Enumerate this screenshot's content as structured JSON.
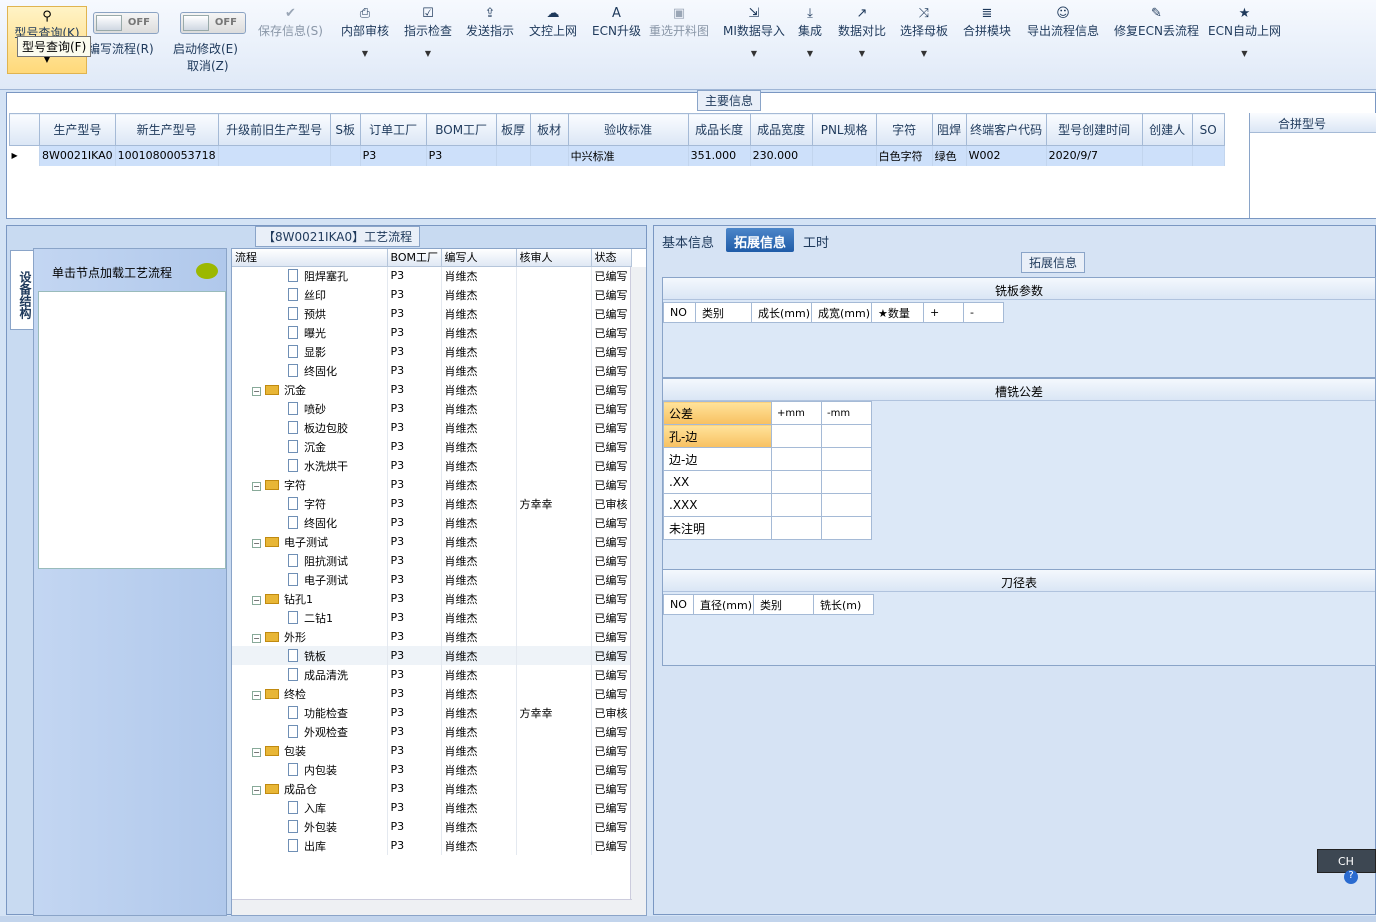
{
  "toolbar": {
    "query_label": "型号查询(K)",
    "tooltip": "型号查询(F)",
    "switch1": {
      "state": "OFF",
      "label": "编写流程(R)"
    },
    "switch2": {
      "state": "OFF",
      "label": "启动修改(E)",
      "label2": "取消(Z)"
    },
    "buttons": [
      {
        "label": "保存信息(S)",
        "icon": "check-icon"
      },
      {
        "label": "内部审核",
        "icon": "print-icon"
      },
      {
        "label": "指示检查",
        "icon": "checklist-icon"
      },
      {
        "label": "发送指示",
        "icon": "upload-icon"
      },
      {
        "label": "文控上网",
        "icon": "cloud-upload-icon"
      },
      {
        "label": "ECN升级",
        "icon": "upgrade-icon"
      },
      {
        "label": "重选开料图",
        "icon": "image-icon"
      },
      {
        "label": "MI数据导入",
        "icon": "import-icon"
      },
      {
        "label": "集成",
        "icon": "download-icon"
      },
      {
        "label": "数据对比",
        "icon": "compare-icon"
      },
      {
        "label": "选择母板",
        "icon": "shuffle-icon"
      },
      {
        "label": "合拼模块",
        "icon": "list-icon"
      },
      {
        "label": "导出流程信息",
        "icon": "smile-icon"
      },
      {
        "label": "修复ECN丢流程",
        "icon": "wrench-icon"
      },
      {
        "label": "ECN自动上网",
        "icon": "star-icon"
      }
    ]
  },
  "main_info": {
    "title": "主要信息",
    "columns": [
      "生产型号",
      "新生产型号",
      "升级前旧生产型号",
      "S板",
      "订单工厂",
      "BOM工厂",
      "板厚",
      "板材",
      "验收标准",
      "成品长度",
      "成品宽度",
      "PNL规格",
      "字符",
      "阻焊",
      "终端客户代码",
      "型号创建时间",
      "创建人",
      "SO"
    ],
    "row": [
      "8W0021IKA0",
      "10010800053718",
      "",
      "",
      "P3",
      "P3",
      "",
      "",
      "中兴标准",
      "351.000",
      "230.000",
      "",
      "白色字符",
      "绿色",
      "W002",
      "2020/9/7",
      "",
      ""
    ],
    "side_header": "合拼型号"
  },
  "process": {
    "title": "【8W0021IKA0】工艺流程",
    "vertical_tab": "设备结构",
    "node_hint": "单击节点加载工艺流程",
    "columns": [
      "流程",
      "BOM工厂",
      "编写人",
      "核审人",
      "状态"
    ],
    "rows": [
      {
        "name": "阻焊塞孔",
        "type": "file",
        "bom": "P3",
        "writer": "肖维杰",
        "reviewer": "",
        "status": "已编写"
      },
      {
        "name": "丝印",
        "type": "file",
        "bom": "P3",
        "writer": "肖维杰",
        "reviewer": "",
        "status": "已编写"
      },
      {
        "name": "预烘",
        "type": "file",
        "bom": "P3",
        "writer": "肖维杰",
        "reviewer": "",
        "status": "已编写"
      },
      {
        "name": "曝光",
        "type": "file",
        "bom": "P3",
        "writer": "肖维杰",
        "reviewer": "",
        "status": "已编写"
      },
      {
        "name": "显影",
        "type": "file",
        "bom": "P3",
        "writer": "肖维杰",
        "reviewer": "",
        "status": "已编写"
      },
      {
        "name": "终固化",
        "type": "file",
        "bom": "P3",
        "writer": "肖维杰",
        "reviewer": "",
        "status": "已编写"
      },
      {
        "name": "沉金",
        "type": "folder",
        "bom": "P3",
        "writer": "肖维杰",
        "reviewer": "",
        "status": "已编写"
      },
      {
        "name": "喷砂",
        "type": "file",
        "bom": "P3",
        "writer": "肖维杰",
        "reviewer": "",
        "status": "已编写"
      },
      {
        "name": "板边包胶",
        "type": "file",
        "bom": "P3",
        "writer": "肖维杰",
        "reviewer": "",
        "status": "已编写"
      },
      {
        "name": "沉金",
        "type": "file",
        "bom": "P3",
        "writer": "肖维杰",
        "reviewer": "",
        "status": "已编写"
      },
      {
        "name": "水洗烘干",
        "type": "file",
        "bom": "P3",
        "writer": "肖维杰",
        "reviewer": "",
        "status": "已编写"
      },
      {
        "name": "字符",
        "type": "folder",
        "bom": "P3",
        "writer": "肖维杰",
        "reviewer": "",
        "status": "已编写"
      },
      {
        "name": "字符",
        "type": "file",
        "bom": "P3",
        "writer": "肖维杰",
        "reviewer": "方幸幸",
        "status": "已审核"
      },
      {
        "name": "终固化",
        "type": "file",
        "bom": "P3",
        "writer": "肖维杰",
        "reviewer": "",
        "status": "已编写"
      },
      {
        "name": "电子测试",
        "type": "folder",
        "bom": "P3",
        "writer": "肖维杰",
        "reviewer": "",
        "status": "已编写"
      },
      {
        "name": "阻抗测试",
        "type": "file",
        "bom": "P3",
        "writer": "肖维杰",
        "reviewer": "",
        "status": "已编写"
      },
      {
        "name": "电子测试",
        "type": "file",
        "bom": "P3",
        "writer": "肖维杰",
        "reviewer": "",
        "status": "已编写"
      },
      {
        "name": "钻孔1",
        "type": "folder",
        "bom": "P3",
        "writer": "肖维杰",
        "reviewer": "",
        "status": "已编写"
      },
      {
        "name": "二钻1",
        "type": "file",
        "bom": "P3",
        "writer": "肖维杰",
        "reviewer": "",
        "status": "已编写"
      },
      {
        "name": "外形",
        "type": "folder",
        "bom": "P3",
        "writer": "肖维杰",
        "reviewer": "",
        "status": "已编写"
      },
      {
        "name": "铣板",
        "type": "file",
        "bom": "P3",
        "writer": "肖维杰",
        "reviewer": "",
        "status": "已编写",
        "selected": true
      },
      {
        "name": "成品清洗",
        "type": "file",
        "bom": "P3",
        "writer": "肖维杰",
        "reviewer": "",
        "status": "已编写"
      },
      {
        "name": "终检",
        "type": "folder",
        "bom": "P3",
        "writer": "肖维杰",
        "reviewer": "",
        "status": "已编写"
      },
      {
        "name": "功能检查",
        "type": "file",
        "bom": "P3",
        "writer": "肖维杰",
        "reviewer": "方幸幸",
        "status": "已审核"
      },
      {
        "name": "外观检查",
        "type": "file",
        "bom": "P3",
        "writer": "肖维杰",
        "reviewer": "",
        "status": "已编写"
      },
      {
        "name": "包装",
        "type": "folder",
        "bom": "P3",
        "writer": "肖维杰",
        "reviewer": "",
        "status": "已编写"
      },
      {
        "name": "内包装",
        "type": "file",
        "bom": "P3",
        "writer": "肖维杰",
        "reviewer": "",
        "status": "已编写"
      },
      {
        "name": "成品仓",
        "type": "folder",
        "bom": "P3",
        "writer": "肖维杰",
        "reviewer": "",
        "status": "已编写"
      },
      {
        "name": "入库",
        "type": "file",
        "bom": "P3",
        "writer": "肖维杰",
        "reviewer": "",
        "status": "已编写"
      },
      {
        "name": "外包装",
        "type": "file",
        "bom": "P3",
        "writer": "肖维杰",
        "reviewer": "",
        "status": "已编写"
      },
      {
        "name": "出库",
        "type": "file",
        "bom": "P3",
        "writer": "肖维杰",
        "reviewer": "",
        "status": "已编写"
      }
    ]
  },
  "right": {
    "tabs": [
      "基本信息",
      "拓展信息",
      "工时"
    ],
    "active_tab": 1,
    "ext_title": "拓展信息",
    "mill_params": {
      "title": "铣板参数",
      "columns": [
        "NO",
        "类别",
        "成长(mm)",
        "成宽(mm)",
        "★数量",
        "+",
        "-"
      ]
    },
    "slot_tol": {
      "title": "槽铣公差",
      "header": [
        "公差",
        "+mm",
        "-mm"
      ],
      "rows": [
        "孔-边",
        "边-边",
        ".XX",
        ".XXX",
        "未注明"
      ]
    },
    "tools": {
      "title": "刀径表",
      "columns": [
        "NO",
        "直径(mm)",
        "类别",
        "铣长(m)"
      ]
    }
  },
  "ime": "CH"
}
